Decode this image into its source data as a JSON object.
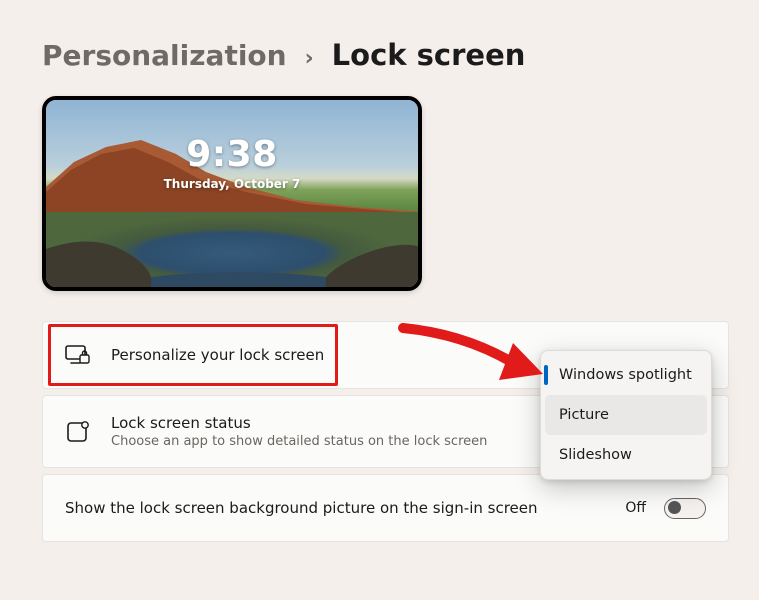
{
  "breadcrumb": {
    "parent": "Personalization",
    "current": "Lock screen"
  },
  "preview": {
    "time": "9:38",
    "date": "Thursday, October 7"
  },
  "cards": {
    "personalize": {
      "title": "Personalize your lock screen"
    },
    "status": {
      "title": "Lock screen status",
      "subtitle": "Choose an app to show detailed status on the lock screen"
    },
    "signin_bg": {
      "title": "Show the lock screen background picture on the sign-in screen",
      "toggle_state": "Off"
    }
  },
  "dropdown": {
    "items": [
      {
        "label": "Windows spotlight",
        "selected": true
      },
      {
        "label": "Picture",
        "hover": true
      },
      {
        "label": "Slideshow"
      }
    ]
  }
}
